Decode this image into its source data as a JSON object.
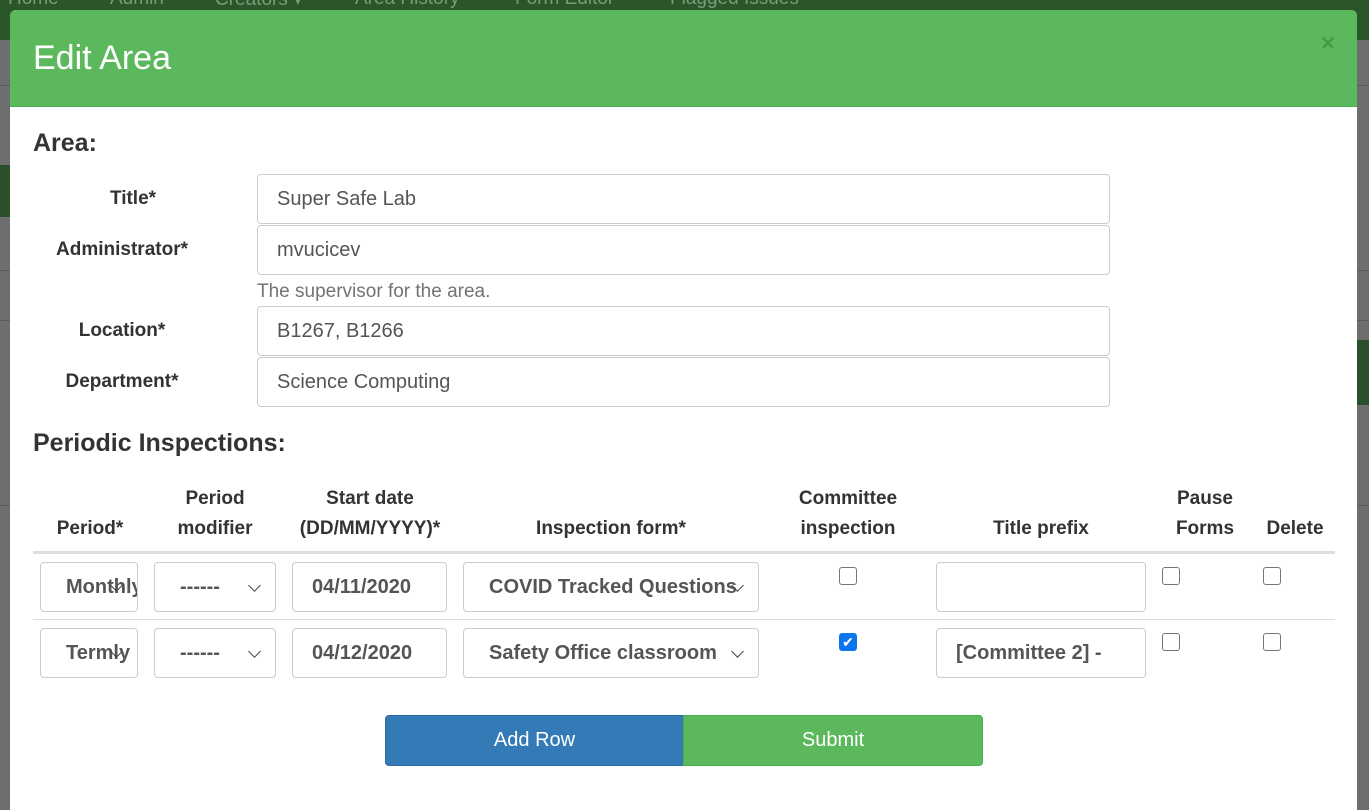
{
  "background_nav": [
    "Home",
    "Admin",
    "Creators ▾",
    "Area History",
    "Form Editor",
    "Flagged Issues"
  ],
  "modal": {
    "title": "Edit Area",
    "close": "×"
  },
  "area": {
    "heading": "Area:",
    "fields": [
      {
        "label": "Title*",
        "value": "Super Safe Lab"
      },
      {
        "label": "Administrator*",
        "value": "mvucicev",
        "help": "The supervisor for the area."
      },
      {
        "label": "Location*",
        "value": "B1267, B1266"
      },
      {
        "label": "Department*",
        "value": "Science Computing"
      }
    ]
  },
  "inspections": {
    "heading": "Periodic Inspections:",
    "columns": [
      [
        "",
        "Period*"
      ],
      [
        "Period",
        "modifier"
      ],
      [
        "Start date",
        "(DD/MM/YYYY)*"
      ],
      [
        "",
        "Inspection form*"
      ],
      [
        "Committee",
        "inspection"
      ],
      [
        "",
        "Title prefix"
      ],
      [
        "Pause",
        "Forms"
      ],
      [
        "",
        "Delete"
      ]
    ],
    "rows": [
      {
        "period": "Monthly",
        "modifier": "------",
        "start_date": "04/11/2020",
        "form": "COVID Tracked Questions",
        "committee": false,
        "title_prefix": "",
        "pause": false,
        "delete": false
      },
      {
        "period": "Termly",
        "modifier": "------",
        "start_date": "04/12/2020",
        "form": "Safety Office classroom",
        "committee": true,
        "title_prefix": "[Committee 2] -",
        "pause": false,
        "delete": false
      }
    ]
  },
  "buttons": {
    "add_row": "Add Row",
    "submit": "Submit"
  },
  "colors": {
    "header": "#5cb85c",
    "add_row": "#337ab7",
    "submit": "#5cb85c",
    "nav": "#2a562a"
  }
}
